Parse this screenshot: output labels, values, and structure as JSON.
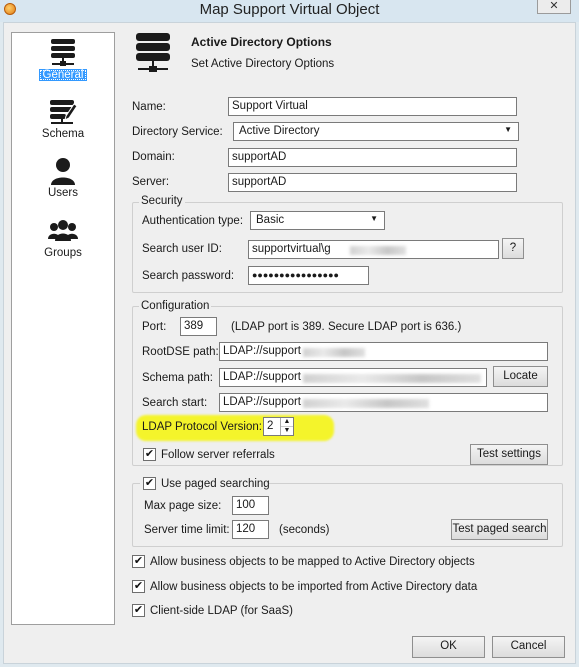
{
  "window": {
    "title": "Map Support Virtual Object",
    "close": "✕"
  },
  "nav": [
    {
      "label": "General",
      "icon": "server-icon",
      "selected": true
    },
    {
      "label": "Schema",
      "icon": "schema-edit-icon"
    },
    {
      "label": "Users",
      "icon": "user-icon"
    },
    {
      "label": "Groups",
      "icon": "group-icon"
    }
  ],
  "header": {
    "title": "Active Directory Options",
    "subtitle": "Set Active Directory Options"
  },
  "form": {
    "name_label": "Name:",
    "name_value": "Support Virtual",
    "dirsvc_label": "Directory Service:",
    "dirsvc_value": "Active Directory",
    "domain_label": "Domain:",
    "domain_value": "supportAD",
    "server_label": "Server:",
    "server_value": "supportAD"
  },
  "security": {
    "title": "Security",
    "auth_label": "Authentication type:",
    "auth_value": "Basic",
    "userid_label": "Search user ID:",
    "userid_value": "supportvirtual\\g",
    "help_button": "?",
    "password_label": "Search password:",
    "password_value": "●●●●●●●●●●●●●●●●"
  },
  "config": {
    "title": "Configuration",
    "port_label": "Port:",
    "port_value": "389",
    "port_note": "(LDAP port is 389.  Secure LDAP port is 636.)",
    "rootdse_label": "RootDSE path:",
    "rootdse_value": "LDAP://support",
    "schema_label": "Schema path:",
    "schema_value": "LDAP://support",
    "locate_button": "Locate",
    "searchstart_label": "Search start:",
    "searchstart_value": "LDAP://support",
    "protocol_label": "LDAP Protocol Version:",
    "protocol_value": "2",
    "referrals_label": "Follow server referrals",
    "test_settings_button": "Test settings"
  },
  "paged": {
    "label": "Use paged searching",
    "maxpage_label": "Max page size:",
    "maxpage_value": "100",
    "timelimit_label": "Server time limit:",
    "timelimit_value": "120",
    "seconds": "(seconds)",
    "test_paged_button": "Test paged search"
  },
  "options": {
    "map_label": "Allow business objects to be mapped to Active Directory objects",
    "import_label": "Allow business objects to be imported from Active Directory data",
    "clientside_label": "Client-side LDAP (for SaaS)"
  },
  "footer": {
    "ok": "OK",
    "cancel": "Cancel"
  },
  "colors": {
    "highlight": "#f4f42b",
    "selected": "#3399ff"
  }
}
